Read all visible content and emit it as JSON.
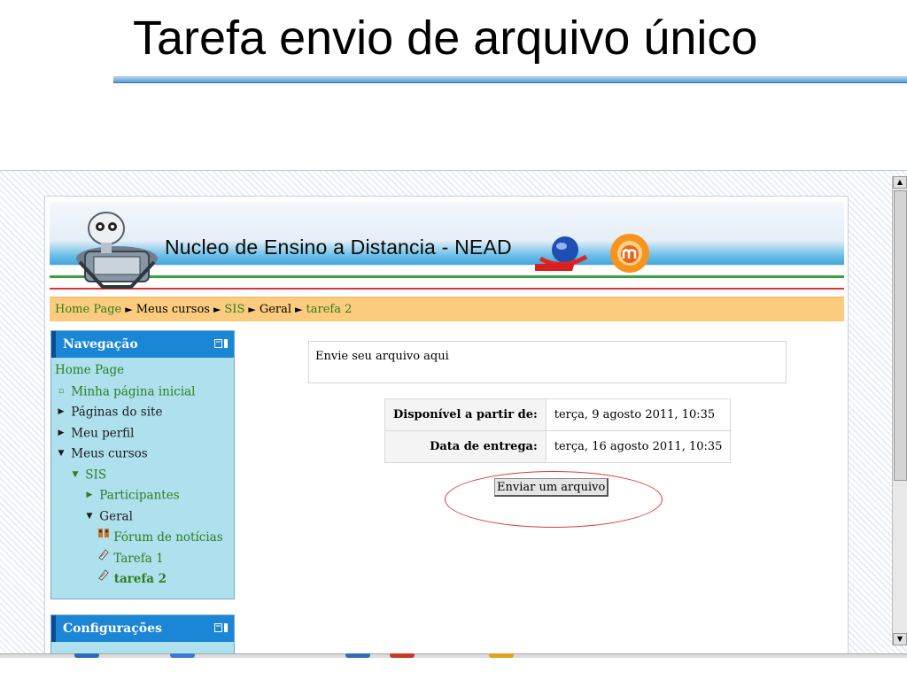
{
  "slide": {
    "title": "Tarefa envio de arquivo único"
  },
  "site": {
    "banner_title": "Nucleo de Ensino a Distancia - NEAD"
  },
  "breadcrumb": [
    {
      "label": "Home Page",
      "link": true
    },
    {
      "label": "Meus cursos",
      "link": false
    },
    {
      "label": "SIS",
      "link": true
    },
    {
      "label": "Geral",
      "link": false
    },
    {
      "label": "tarefa 2",
      "link": true
    }
  ],
  "breadcrumb_separator": "►",
  "navigation": {
    "title": "Navegação",
    "items": [
      {
        "label": "Home Page",
        "indent": 0,
        "icon": "none",
        "link": true
      },
      {
        "label": "Minha página inicial",
        "indent": 0,
        "icon": "bullet",
        "link": true
      },
      {
        "label": "Páginas do site",
        "indent": 0,
        "icon": "collapsed",
        "link": false
      },
      {
        "label": "Meu perfil",
        "indent": 0,
        "icon": "collapsed",
        "link": false
      },
      {
        "label": "Meus cursos",
        "indent": 0,
        "icon": "expanded",
        "link": false
      },
      {
        "label": "SIS",
        "indent": 1,
        "icon": "expanded",
        "link": true
      },
      {
        "label": "Participantes",
        "indent": 2,
        "icon": "collapsed",
        "link": true
      },
      {
        "label": "Geral",
        "indent": 2,
        "icon": "expanded",
        "link": false
      },
      {
        "label": "Fórum de notícias",
        "indent": 3,
        "icon": "forum",
        "link": true
      },
      {
        "label": "Tarefa 1",
        "indent": 3,
        "icon": "assignment",
        "link": true
      },
      {
        "label": "tarefa 2",
        "indent": 3,
        "icon": "assignment",
        "link": true,
        "bold": true
      }
    ]
  },
  "settings": {
    "title": "Configurações"
  },
  "assignment": {
    "description": "Envie seu arquivo aqui",
    "available_label": "Disponível a partir de:",
    "available_value": "terça, 9 agosto 2011, 10:35",
    "due_label": "Data de entrega:",
    "due_value": "terça, 16 agosto 2011, 10:35",
    "upload_button": "Enviar um arquivo"
  },
  "colors": {
    "breadcrumb_bg": "#fbcb7e",
    "block_bg": "#aee0ee",
    "block_header": "#1c86d6",
    "link": "#2e7d1f",
    "highlight": "#e03a3a"
  }
}
